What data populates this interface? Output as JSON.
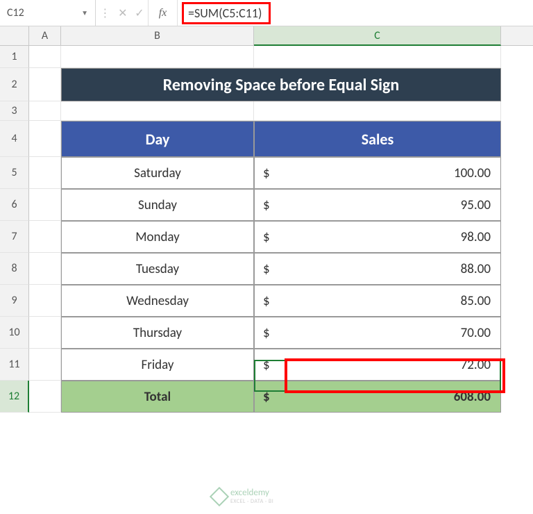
{
  "name_box": "C12",
  "fx_label": "fx",
  "formula": "=SUM(C5:C11)",
  "columns": [
    "A",
    "B",
    "C"
  ],
  "rows": [
    "1",
    "2",
    "3",
    "4",
    "5",
    "6",
    "7",
    "8",
    "9",
    "10",
    "11",
    "12"
  ],
  "title": "Removing Space before Equal Sign",
  "headers": {
    "day": "Day",
    "sales": "Sales"
  },
  "currency": "$",
  "data": [
    {
      "day": "Saturday",
      "sales": "100.00"
    },
    {
      "day": "Sunday",
      "sales": "95.00"
    },
    {
      "day": "Monday",
      "sales": "98.00"
    },
    {
      "day": "Tuesday",
      "sales": "88.00"
    },
    {
      "day": "Wednesday",
      "sales": "85.00"
    },
    {
      "day": "Thursday",
      "sales": "70.00"
    },
    {
      "day": "Friday",
      "sales": "72.00"
    }
  ],
  "total": {
    "label": "Total",
    "sales": "608.00"
  },
  "watermark": {
    "name": "exceldemy",
    "sub": "EXCEL · DATA · BI"
  }
}
